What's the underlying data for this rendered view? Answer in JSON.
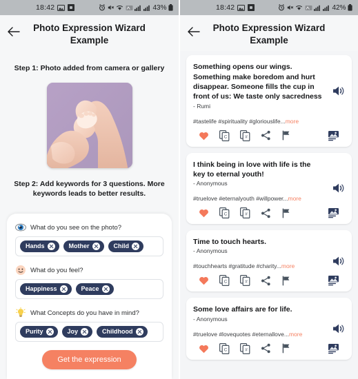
{
  "left": {
    "statusbar": {
      "time": "18:42",
      "battery": "43%",
      "icons": [
        "image-icon",
        "app-icon",
        "alarm-icon",
        "mute-icon",
        "wifi-icon",
        "nfc-icon",
        "signal-icon",
        "signal-icon-2",
        "battery-icon"
      ]
    },
    "appbar": {
      "title": "Photo Expression Wizard Example",
      "back": "back-arrow"
    },
    "step1_label": "Step 1: Photo added from camera or gallery",
    "photo_alt": "baby feet held in adult hands on lavender background",
    "step2_label": "Step 2: Add keywords for 3 questions. More keywords leads to better results.",
    "questions": [
      {
        "emoji": "eye-icon",
        "label": "What do you see on the photo?",
        "chips": [
          "Hands",
          "Mother",
          "Child"
        ]
      },
      {
        "emoji": "smiley-icon",
        "label": "What do you feel?",
        "chips": [
          "Happiness",
          "Peace"
        ]
      },
      {
        "emoji": "lightbulb-icon",
        "label": "What Concepts do you have in mind?",
        "chips": [
          "Purity",
          "Joy",
          "Childhood"
        ]
      }
    ],
    "cta_label": "Get the expression"
  },
  "right": {
    "statusbar": {
      "time": "18:42",
      "battery": "42%"
    },
    "appbar": {
      "title": "Photo Expression Wizard Example",
      "back": "back-arrow"
    },
    "cards": [
      {
        "quote": "Something opens our wings. Something make boredom and hurt disappear. Someone fills the cup in front of us: We taste only sacredness",
        "author": "- Rumi",
        "tags": "#tastelife #spirituality #gloriouslife...",
        "more": "more"
      },
      {
        "quote": "I think being in love with life is the key to eternal youth!",
        "author": "- Anonymous",
        "tags": "#truelove #eternalyouth #willpower...",
        "more": "more"
      },
      {
        "quote": "Time to touch hearts.",
        "author": "- Anonymous",
        "tags": "#touchhearts #gratitude #charity...",
        "more": "more"
      },
      {
        "quote": "Some love affairs are for life.",
        "author": "- Anonymous",
        "tags": "#truelove #lovequotes #eternallove...",
        "more": "more"
      }
    ],
    "action_icons": [
      "heart-icon",
      "copy-quote-icon",
      "copy-hashtags-icon",
      "share-icon",
      "flag-icon",
      "image-export-icon"
    ],
    "speaker_icon": "speaker-icon"
  },
  "colors": {
    "accent": "#f58162",
    "chip": "#2f3c5e",
    "statusbar": "#b8bcbf",
    "page_bg": "#f4f5f7",
    "card_bg": "#ffffff",
    "text": "#17181a"
  }
}
